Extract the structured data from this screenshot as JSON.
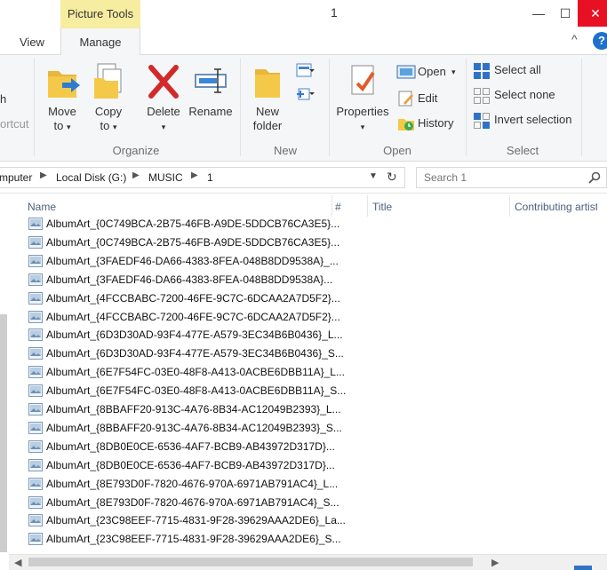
{
  "window": {
    "context_tab": "Picture Tools",
    "title": "1",
    "min_symbol": "—",
    "max_symbol": "☐",
    "close_symbol": "✕"
  },
  "tabs": {
    "view": "View",
    "manage": "Manage",
    "collapse_symbol": "^",
    "help_symbol": "?"
  },
  "ribbon": {
    "partial_left_top": "h",
    "partial_left_bottom": "ortcut",
    "organize": {
      "label": "Organize",
      "move_to": "Move",
      "move_to_line2": "to",
      "copy_to": "Copy",
      "copy_to_line2": "to",
      "delete": "Delete",
      "rename": "Rename"
    },
    "new": {
      "label": "New",
      "new_folder": "New",
      "new_folder_line2": "folder"
    },
    "open": {
      "label": "Open",
      "properties": "Properties",
      "open": "Open",
      "edit": "Edit",
      "history": "History"
    },
    "select": {
      "label": "Select",
      "select_all": "Select all",
      "select_none": "Select none",
      "invert_selection": "Invert selection"
    }
  },
  "address": {
    "crumbs": [
      "mputer",
      "Local Disk (G:)",
      "MUSIC",
      "1"
    ],
    "search_placeholder": "Search 1"
  },
  "columns": {
    "name": "Name",
    "number": "#",
    "title": "Title",
    "contributing_artist": "Contributing artist"
  },
  "files": [
    "AlbumArt_{0C749BCA-2B75-46FB-A9DE-5DDCB76CA3E5}...",
    "AlbumArt_{0C749BCA-2B75-46FB-A9DE-5DDCB76CA3E5}...",
    "AlbumArt_{3FAEDF46-DA66-4383-8FEA-048B8DD9538A}_...",
    "AlbumArt_{3FAEDF46-DA66-4383-8FEA-048B8DD9538A}...",
    "AlbumArt_{4FCCBABC-7200-46FE-9C7C-6DCAA2A7D5F2}...",
    "AlbumArt_{4FCCBABC-7200-46FE-9C7C-6DCAA2A7D5F2}...",
    "AlbumArt_{6D3D30AD-93F4-477E-A579-3EC34B6B0436}_L...",
    "AlbumArt_{6D3D30AD-93F4-477E-A579-3EC34B6B0436}_S...",
    "AlbumArt_{6E7F54FC-03E0-48F8-A413-0ACBE6DBB11A}_L...",
    "AlbumArt_{6E7F54FC-03E0-48F8-A413-0ACBE6DBB11A}_S...",
    "AlbumArt_{8BBAFF20-913C-4A76-8B34-AC12049B2393}_L...",
    "AlbumArt_{8BBAFF20-913C-4A76-8B34-AC12049B2393}_S...",
    "AlbumArt_{8DB0E0CE-6536-4AF7-BCB9-AB43972D317D}...",
    "AlbumArt_{8DB0E0CE-6536-4AF7-BCB9-AB43972D317D}...",
    "AlbumArt_{8E793D0F-7820-4676-970A-6971AB791AC4}_L...",
    "AlbumArt_{8E793D0F-7820-4676-970A-6971AB791AC4}_S...",
    "AlbumArt_{23C98EEF-7715-4831-9F28-39629AAA2DE6}_La...",
    "AlbumArt_{23C98EEF-7715-4831-9F28-39629AAA2DE6}_S..."
  ],
  "colors": {
    "context_tab": "#f7eda1",
    "accent_blue": "#1e70cd",
    "close_red": "#e81123",
    "folder_yellow": "#f4c94a"
  }
}
